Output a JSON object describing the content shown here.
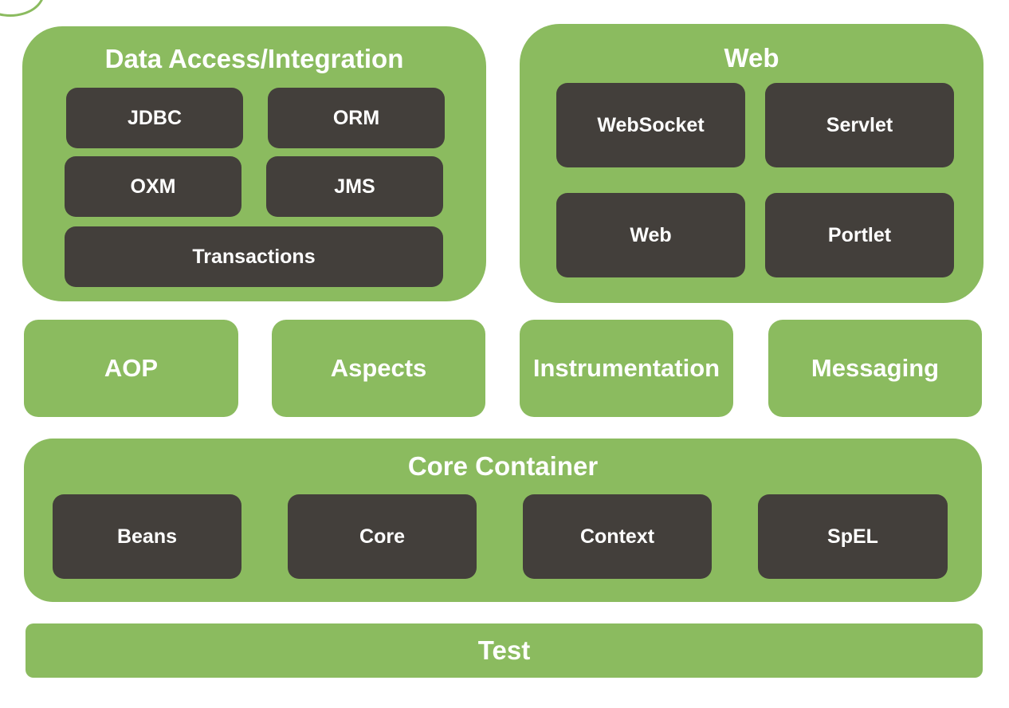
{
  "data_access": {
    "title": "Data Access/Integration",
    "modules": [
      "JDBC",
      "ORM",
      "OXM",
      "JMS",
      "Transactions"
    ]
  },
  "web": {
    "title": "Web",
    "modules": [
      "WebSocket",
      "Servlet",
      "Web",
      "Portlet"
    ]
  },
  "middle": [
    "AOP",
    "Aspects",
    "Instrumentation",
    "Messaging"
  ],
  "core": {
    "title": "Core Container",
    "modules": [
      "Beans",
      "Core",
      "Context",
      "SpEL"
    ]
  },
  "test": "Test",
  "colors": {
    "group": "#8bbb5f",
    "module": "#433f3b",
    "text": "#ffffff"
  }
}
